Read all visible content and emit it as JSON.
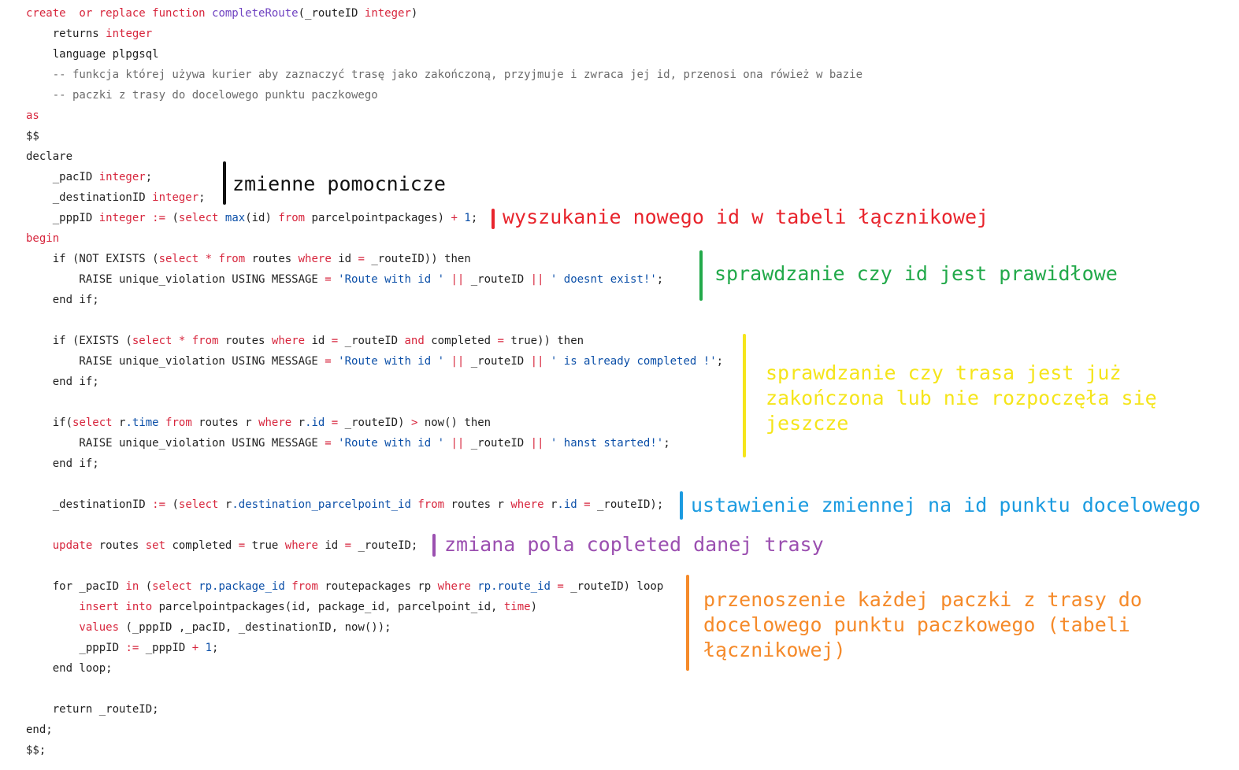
{
  "code_lines": [
    [
      {
        "t": "create  or replace function ",
        "c": "kw"
      },
      {
        "t": "completeRoute",
        "c": "fn"
      },
      {
        "t": "(_routeID ",
        "c": "pl"
      },
      {
        "t": "integer",
        "c": "kw"
      },
      {
        "t": ")",
        "c": "pl"
      }
    ],
    [
      {
        "t": "    returns ",
        "c": "pl"
      },
      {
        "t": "integer",
        "c": "kw"
      }
    ],
    [
      {
        "t": "    language plpgsql",
        "c": "pl"
      }
    ],
    [
      {
        "t": "    -- funkcja której używa kurier aby zaznaczyć trasę jako zakończoną, przyjmuje i zwraca jej id, przenosi ona rówież w bazie",
        "c": "cm"
      }
    ],
    [
      {
        "t": "    -- paczki z trasy do docelowego punktu paczkowego",
        "c": "cm"
      }
    ],
    [
      {
        "t": "as",
        "c": "kw"
      }
    ],
    [
      {
        "t": "$$",
        "c": "pl"
      }
    ],
    [
      {
        "t": "declare",
        "c": "pl"
      }
    ],
    [
      {
        "t": "    _pacID ",
        "c": "pl"
      },
      {
        "t": "integer",
        "c": "kw"
      },
      {
        "t": ";",
        "c": "pl"
      }
    ],
    [
      {
        "t": "    _destinationID ",
        "c": "pl"
      },
      {
        "t": "integer",
        "c": "kw"
      },
      {
        "t": ";",
        "c": "pl"
      }
    ],
    [
      {
        "t": "    _pppID ",
        "c": "pl"
      },
      {
        "t": "integer",
        "c": "kw"
      },
      {
        "t": " := ",
        "c": "op"
      },
      {
        "t": "(",
        "c": "pl"
      },
      {
        "t": "select ",
        "c": "kw"
      },
      {
        "t": "max",
        "c": "id"
      },
      {
        "t": "(id) ",
        "c": "pl"
      },
      {
        "t": "from ",
        "c": "kw"
      },
      {
        "t": "parcelpointpackages) ",
        "c": "pl"
      },
      {
        "t": "+ ",
        "c": "op"
      },
      {
        "t": "1",
        "c": "num"
      },
      {
        "t": ";",
        "c": "pl"
      }
    ],
    [
      {
        "t": "begin",
        "c": "kw"
      }
    ],
    [
      {
        "t": "    if (NOT EXISTS (",
        "c": "pl"
      },
      {
        "t": "select ",
        "c": "kw"
      },
      {
        "t": "* ",
        "c": "op"
      },
      {
        "t": "from ",
        "c": "kw"
      },
      {
        "t": "routes ",
        "c": "pl"
      },
      {
        "t": "where ",
        "c": "kw"
      },
      {
        "t": "id ",
        "c": "pl"
      },
      {
        "t": "= ",
        "c": "op"
      },
      {
        "t": "_routeID)) then",
        "c": "pl"
      }
    ],
    [
      {
        "t": "        RAISE unique_violation USING MESSAGE ",
        "c": "pl"
      },
      {
        "t": "= ",
        "c": "op"
      },
      {
        "t": "'Route with id '",
        "c": "str"
      },
      {
        "t": " ",
        "c": "pl"
      },
      {
        "t": "||",
        "c": "op"
      },
      {
        "t": " _routeID ",
        "c": "pl"
      },
      {
        "t": "||",
        "c": "op"
      },
      {
        "t": " ",
        "c": "pl"
      },
      {
        "t": "' doesnt exist!'",
        "c": "str"
      },
      {
        "t": ";",
        "c": "pl"
      }
    ],
    [
      {
        "t": "    end if;",
        "c": "pl"
      }
    ],
    [],
    [
      {
        "t": "    if (EXISTS (",
        "c": "pl"
      },
      {
        "t": "select ",
        "c": "kw"
      },
      {
        "t": "* ",
        "c": "op"
      },
      {
        "t": "from ",
        "c": "kw"
      },
      {
        "t": "routes ",
        "c": "pl"
      },
      {
        "t": "where ",
        "c": "kw"
      },
      {
        "t": "id ",
        "c": "pl"
      },
      {
        "t": "= ",
        "c": "op"
      },
      {
        "t": "_routeID ",
        "c": "pl"
      },
      {
        "t": "and ",
        "c": "kw"
      },
      {
        "t": "completed ",
        "c": "pl"
      },
      {
        "t": "= ",
        "c": "op"
      },
      {
        "t": "true)) then",
        "c": "pl"
      }
    ],
    [
      {
        "t": "        RAISE unique_violation USING MESSAGE ",
        "c": "pl"
      },
      {
        "t": "= ",
        "c": "op"
      },
      {
        "t": "'Route with id '",
        "c": "str"
      },
      {
        "t": " ",
        "c": "pl"
      },
      {
        "t": "||",
        "c": "op"
      },
      {
        "t": " _routeID ",
        "c": "pl"
      },
      {
        "t": "||",
        "c": "op"
      },
      {
        "t": " ",
        "c": "pl"
      },
      {
        "t": "' is already completed !'",
        "c": "str"
      },
      {
        "t": ";",
        "c": "pl"
      }
    ],
    [
      {
        "t": "    end if;",
        "c": "pl"
      }
    ],
    [],
    [
      {
        "t": "    if(",
        "c": "pl"
      },
      {
        "t": "select ",
        "c": "kw"
      },
      {
        "t": "r",
        "c": "pl"
      },
      {
        "t": ".time ",
        "c": "id"
      },
      {
        "t": "from ",
        "c": "kw"
      },
      {
        "t": "routes r ",
        "c": "pl"
      },
      {
        "t": "where ",
        "c": "kw"
      },
      {
        "t": "r",
        "c": "pl"
      },
      {
        "t": ".id ",
        "c": "id"
      },
      {
        "t": "= ",
        "c": "op"
      },
      {
        "t": "_routeID) ",
        "c": "pl"
      },
      {
        "t": "> ",
        "c": "op"
      },
      {
        "t": "now() then",
        "c": "pl"
      }
    ],
    [
      {
        "t": "        RAISE unique_violation USING MESSAGE ",
        "c": "pl"
      },
      {
        "t": "= ",
        "c": "op"
      },
      {
        "t": "'Route with id '",
        "c": "str"
      },
      {
        "t": " ",
        "c": "pl"
      },
      {
        "t": "||",
        "c": "op"
      },
      {
        "t": " _routeID ",
        "c": "pl"
      },
      {
        "t": "||",
        "c": "op"
      },
      {
        "t": " ",
        "c": "pl"
      },
      {
        "t": "' hanst started!'",
        "c": "str"
      },
      {
        "t": ";",
        "c": "pl"
      }
    ],
    [
      {
        "t": "    end if;",
        "c": "pl"
      }
    ],
    [],
    [
      {
        "t": "    _destinationID ",
        "c": "pl"
      },
      {
        "t": ":= ",
        "c": "op"
      },
      {
        "t": "(",
        "c": "pl"
      },
      {
        "t": "select ",
        "c": "kw"
      },
      {
        "t": "r",
        "c": "pl"
      },
      {
        "t": ".destination_parcelpoint_id ",
        "c": "id"
      },
      {
        "t": "from ",
        "c": "kw"
      },
      {
        "t": "routes r ",
        "c": "pl"
      },
      {
        "t": "where ",
        "c": "kw"
      },
      {
        "t": "r",
        "c": "pl"
      },
      {
        "t": ".id ",
        "c": "id"
      },
      {
        "t": "= ",
        "c": "op"
      },
      {
        "t": "_routeID);",
        "c": "pl"
      }
    ],
    [],
    [
      {
        "t": "    update ",
        "c": "kw"
      },
      {
        "t": "routes ",
        "c": "pl"
      },
      {
        "t": "set ",
        "c": "kw"
      },
      {
        "t": "completed ",
        "c": "pl"
      },
      {
        "t": "= ",
        "c": "op"
      },
      {
        "t": "true ",
        "c": "pl"
      },
      {
        "t": "where ",
        "c": "kw"
      },
      {
        "t": "id ",
        "c": "pl"
      },
      {
        "t": "= ",
        "c": "op"
      },
      {
        "t": "_routeID;",
        "c": "pl"
      }
    ],
    [],
    [
      {
        "t": "    for _pacID ",
        "c": "pl"
      },
      {
        "t": "in ",
        "c": "kw"
      },
      {
        "t": "(",
        "c": "pl"
      },
      {
        "t": "select ",
        "c": "kw"
      },
      {
        "t": "rp",
        "c": "id"
      },
      {
        "t": ".package_id ",
        "c": "id"
      },
      {
        "t": "from ",
        "c": "kw"
      },
      {
        "t": "routepackages rp ",
        "c": "pl"
      },
      {
        "t": "where ",
        "c": "kw"
      },
      {
        "t": "rp",
        "c": "id"
      },
      {
        "t": ".route_id ",
        "c": "id"
      },
      {
        "t": "= ",
        "c": "op"
      },
      {
        "t": "_routeID) loop",
        "c": "pl"
      }
    ],
    [
      {
        "t": "        insert into ",
        "c": "kw"
      },
      {
        "t": "parcelpointpackages(id, package_id, parcelpoint_id, ",
        "c": "pl"
      },
      {
        "t": "time",
        "c": "kw"
      },
      {
        "t": ")",
        "c": "pl"
      }
    ],
    [
      {
        "t": "        values ",
        "c": "kw"
      },
      {
        "t": "(_pppID ,_pacID, _destinationID, now());",
        "c": "pl"
      }
    ],
    [
      {
        "t": "        _pppID ",
        "c": "pl"
      },
      {
        "t": ":= ",
        "c": "op"
      },
      {
        "t": "_pppID ",
        "c": "pl"
      },
      {
        "t": "+ ",
        "c": "op"
      },
      {
        "t": "1",
        "c": "num"
      },
      {
        "t": ";",
        "c": "pl"
      }
    ],
    [
      {
        "t": "    end loop;",
        "c": "pl"
      }
    ],
    [],
    [
      {
        "t": "    return _routeID;",
        "c": "pl"
      }
    ],
    [
      {
        "t": "end;",
        "c": "pl"
      }
    ],
    [
      {
        "t": "$$;",
        "c": "pl"
      }
    ]
  ],
  "annotations": [
    {
      "name": "annotation-helper-variables",
      "lines": [
        "zmienne pomocnicze"
      ],
      "color": "#111111"
    },
    {
      "name": "annotation-new-id-lookup",
      "lines": [
        "wyszukanie nowego id w tabeli łącznikowej"
      ],
      "color": "#e8242c"
    },
    {
      "name": "annotation-id-validation",
      "lines": [
        "sprawdzanie czy id jest prawidłowe"
      ],
      "color": "#22a94a"
    },
    {
      "name": "annotation-route-state-check",
      "lines": [
        "sprawdzanie czy trasa jest już",
        "zakończona lub nie rozpoczęła się",
        "jeszcze"
      ],
      "color": "#f5e51b"
    },
    {
      "name": "annotation-destination-variable",
      "lines": [
        "ustawienie zmiennej na id punktu docelowego"
      ],
      "color": "#1b9be0"
    },
    {
      "name": "annotation-completed-field",
      "lines": [
        "zmiana pola copleted danej trasy"
      ],
      "color": "#9b4fb0"
    },
    {
      "name": "annotation-package-transfer",
      "lines": [
        "przenoszenie każdej paczki z trasy do",
        "docelowego punktu paczkowego (tabeli",
        "łącznikowej)"
      ],
      "color": "#f58a2a"
    }
  ]
}
